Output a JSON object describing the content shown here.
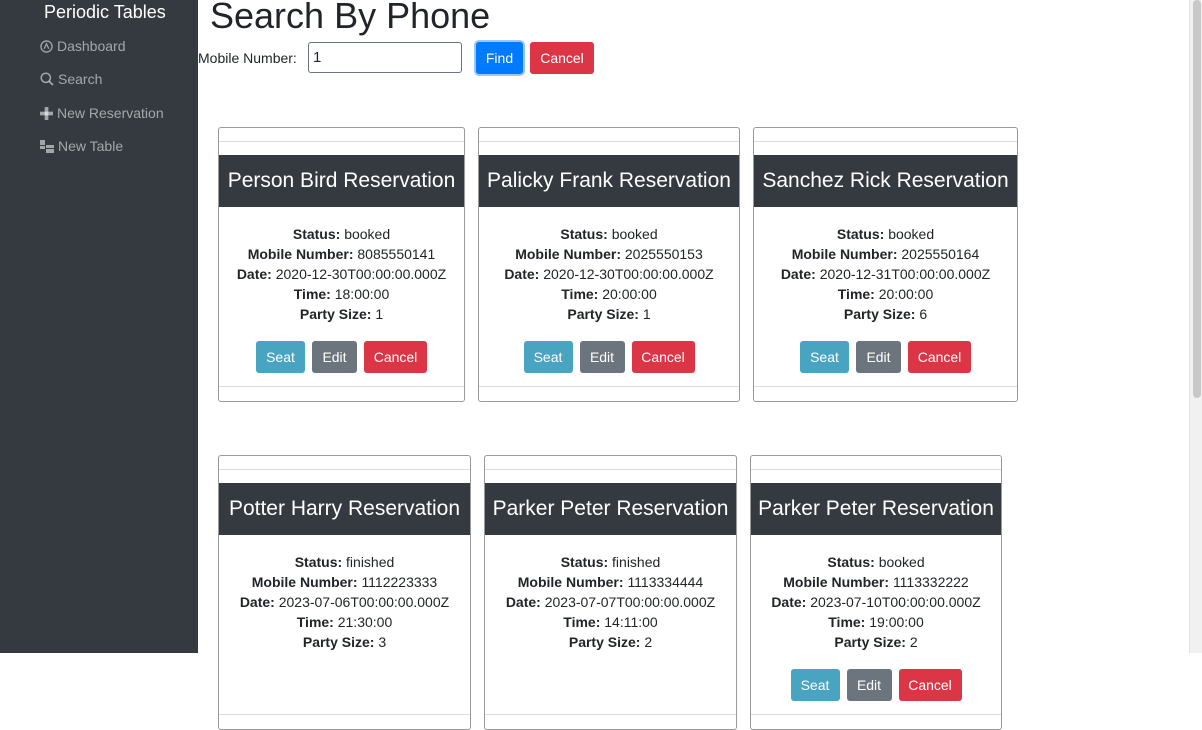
{
  "sidebar": {
    "brand": "Periodic Tables",
    "items": [
      {
        "label": "Dashboard",
        "icon": "dashboard-icon"
      },
      {
        "label": "Search",
        "icon": "search-icon"
      },
      {
        "label": "New Reservation",
        "icon": "plus-icon"
      },
      {
        "label": "New Table",
        "icon": "table-icon"
      }
    ]
  },
  "main": {
    "title": "Search By Phone",
    "form": {
      "label": "Mobile Number:",
      "value": "1",
      "find_label": "Find",
      "cancel_label": "Cancel"
    }
  },
  "labels": {
    "status": "Status:",
    "mobile": "Mobile Number:",
    "date": "Date:",
    "time": "Time:",
    "party": "Party Size:",
    "seat": "Seat",
    "edit": "Edit",
    "cancel": "Cancel"
  },
  "reservations": [
    {
      "title": "Person Bird Reservation",
      "status": "booked",
      "mobile": "8085550141",
      "date": "2020-12-30T00:00:00.000Z",
      "time": "18:00:00",
      "party": "1"
    },
    {
      "title": "Palicky Frank Reservation",
      "status": "booked",
      "mobile": "2025550153",
      "date": "2020-12-30T00:00:00.000Z",
      "time": "20:00:00",
      "party": "1"
    },
    {
      "title": "Sanchez Rick Reservation",
      "status": "booked",
      "mobile": "2025550164",
      "date": "2020-12-31T00:00:00.000Z",
      "time": "20:00:00",
      "party": "6"
    },
    {
      "title": "Potter Harry Reservation",
      "status": "finished",
      "mobile": "1112223333",
      "date": "2023-07-06T00:00:00.000Z",
      "time": "21:30:00",
      "party": "3"
    },
    {
      "title": "Parker Peter Reservation",
      "status": "finished",
      "mobile": "1113334444",
      "date": "2023-07-07T00:00:00.000Z",
      "time": "14:11:00",
      "party": "2"
    },
    {
      "title": "Parker Peter Reservation",
      "status": "booked",
      "mobile": "1113332222",
      "date": "2023-07-10T00:00:00.000Z",
      "time": "19:00:00",
      "party": "2"
    }
  ],
  "colors": {
    "sidebar_bg": "#343a40",
    "primary": "#007bff",
    "danger": "#dc3545",
    "info": "#48a4c0",
    "secondary": "#6c757d"
  }
}
